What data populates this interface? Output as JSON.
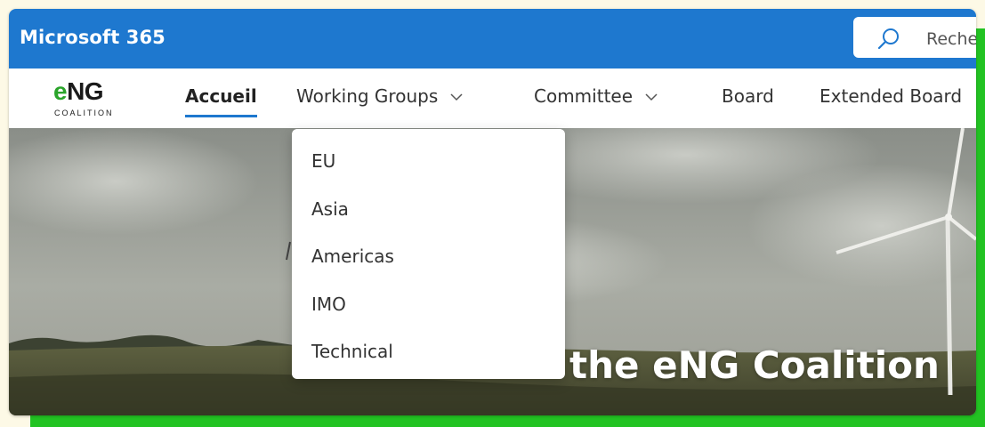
{
  "suite_bar": {
    "title": "Microsoft 365",
    "search_text": "Reche",
    "color": "#1e78cf"
  },
  "logo": {
    "letter_e": "e",
    "letters_ng": "NG",
    "subtitle": "COALITION",
    "accent_color": "#2aa42a"
  },
  "nav": {
    "items": [
      {
        "label": "Accueil",
        "active": true
      },
      {
        "label": "Working Groups",
        "has_dropdown": true,
        "expanded": true
      },
      {
        "label": "Committee",
        "has_dropdown": true
      },
      {
        "label": "Board"
      },
      {
        "label": "Extended Board"
      }
    ]
  },
  "dropdown": {
    "items": [
      "EU",
      "Asia",
      "Americas",
      "IMO",
      "Technical"
    ]
  },
  "hero": {
    "title": "the eNG Coalition"
  }
}
